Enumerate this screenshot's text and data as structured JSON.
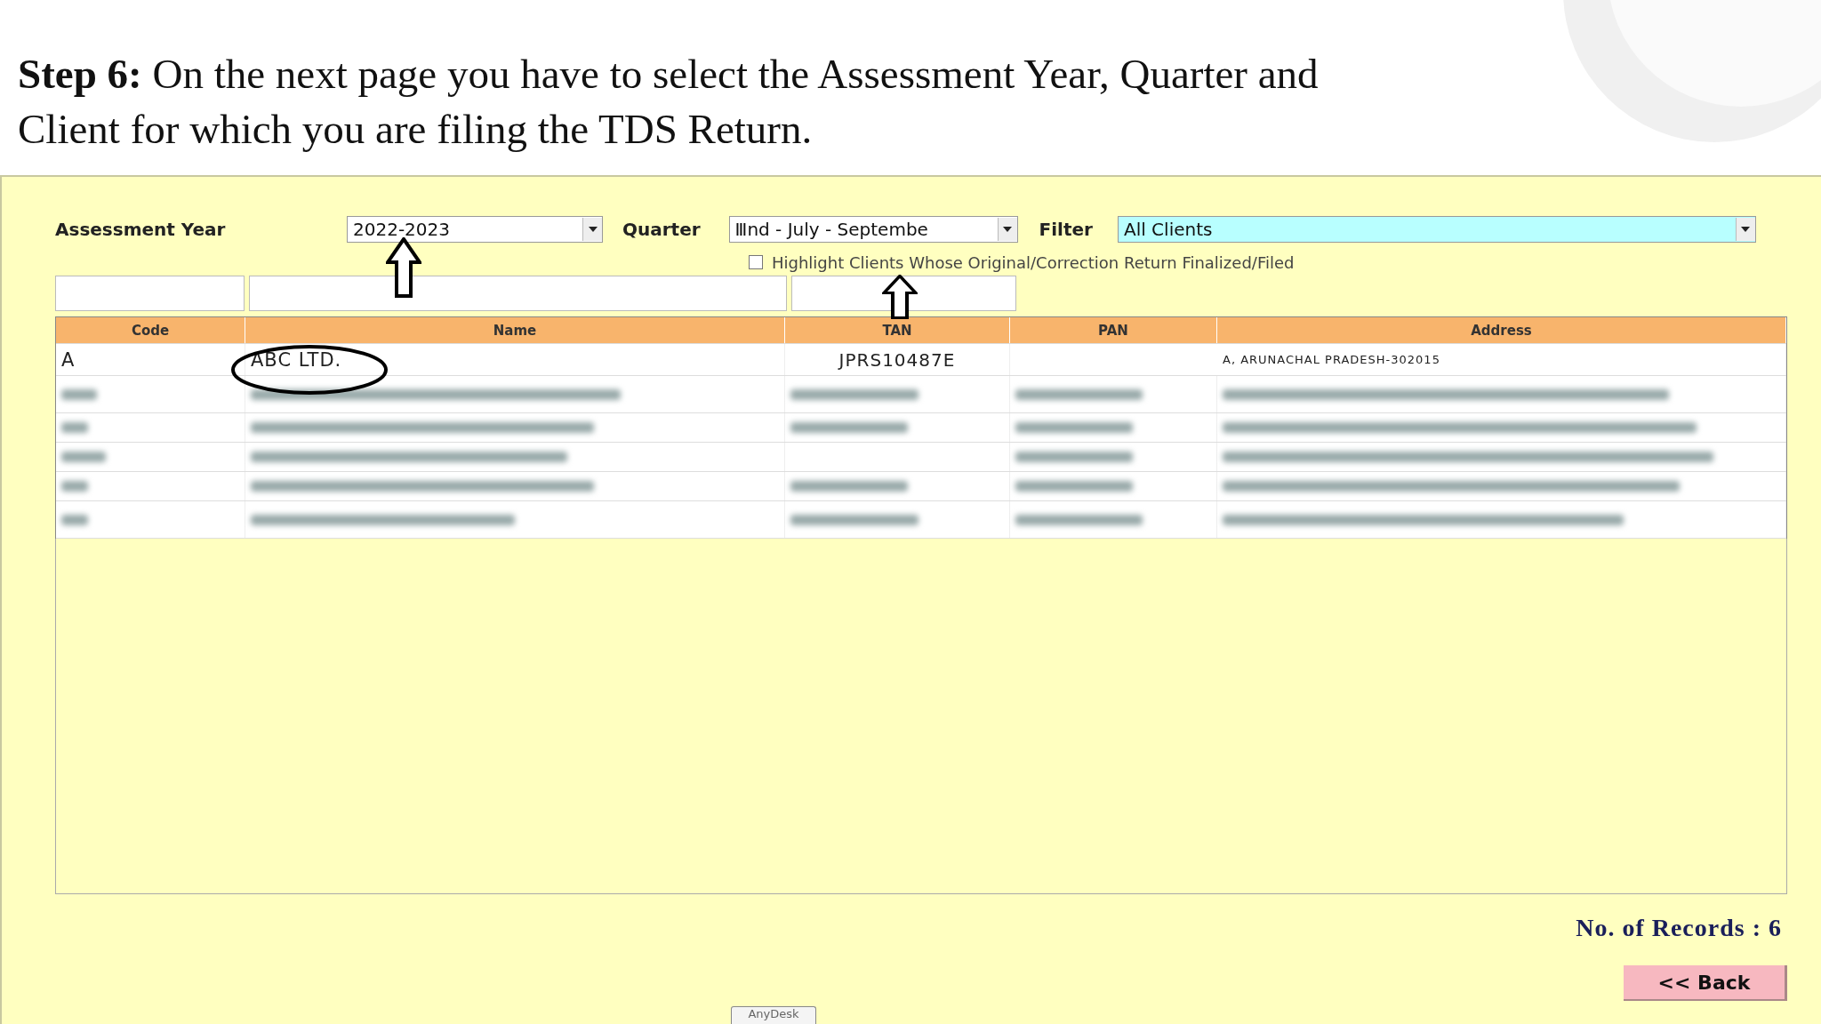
{
  "slide": {
    "heading": "**Step 6:** On the next page you have to select the Assessment Year, Quarter and Client for which you are filing the TDS Return."
  },
  "form": {
    "assessment_year": {
      "label": "Assessment Year",
      "value": "2022-2023"
    },
    "quarter": {
      "label": "Quarter",
      "value": "Ⅲnd - July - Septembe"
    },
    "filter": {
      "label": "Filter",
      "value": "All Clients"
    },
    "highlight": {
      "label": "Highlight Clients Whose Original/Correction Return Finalized/Filed",
      "checked": false
    }
  },
  "table": {
    "columns": [
      "Code",
      "Name",
      "TAN",
      "PAN",
      "Address"
    ],
    "rows": [
      {
        "kind": "visible",
        "cells": [
          "A",
          "ABC LTD.",
          "JPRS10487E",
          "",
          "A, ARUNACHAL PRADESH-302015"
        ],
        "circled": true
      },
      {
        "kind": "blurred"
      },
      {
        "kind": "blurred"
      },
      {
        "kind": "blurred"
      },
      {
        "kind": "blurred"
      },
      {
        "kind": "blurred"
      }
    ]
  },
  "records": "No. of Records : 6",
  "back_button": "<< Back",
  "anydesk_tab": "AnyDesk"
}
